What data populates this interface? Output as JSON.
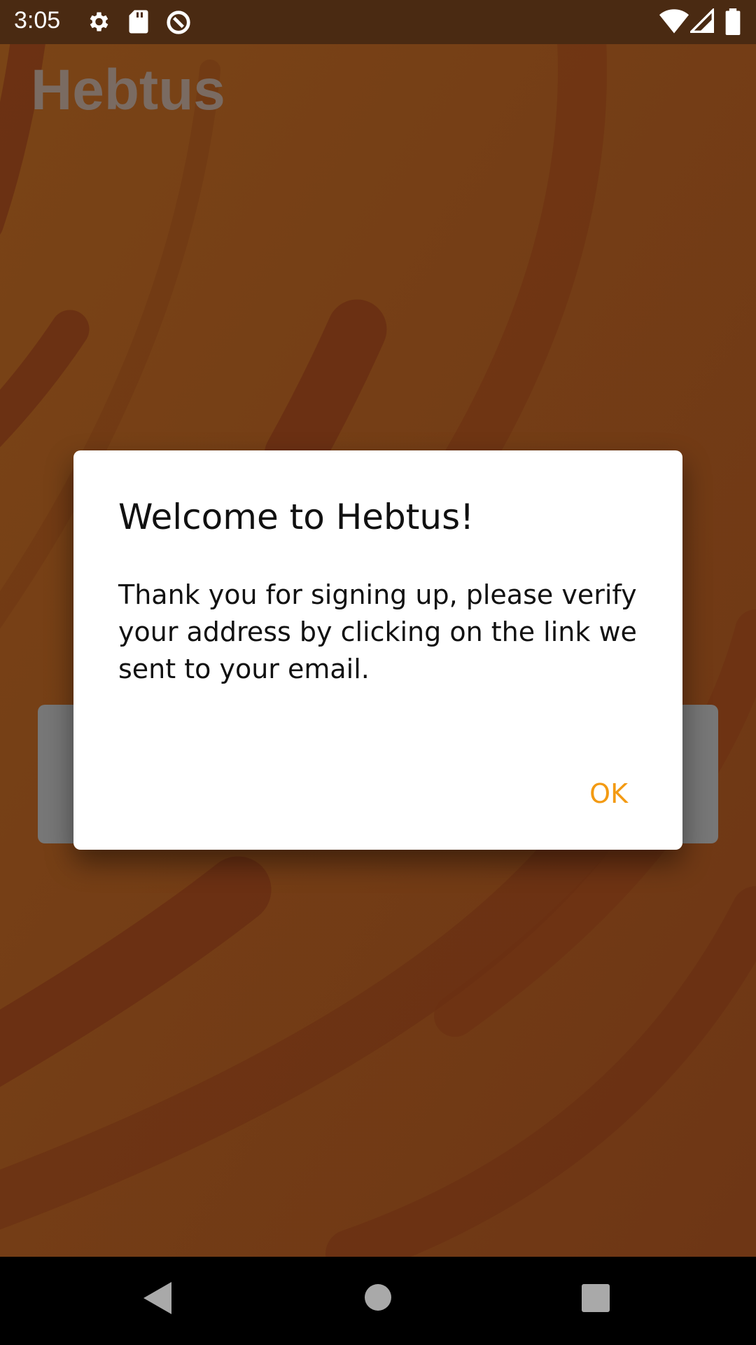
{
  "status_bar": {
    "time": "3:05",
    "left_icons": [
      "gear-icon",
      "sd-card-icon",
      "location-off-icon"
    ],
    "right_icons": [
      "wifi-icon",
      "signal-icon",
      "battery-icon"
    ]
  },
  "app": {
    "title": "Hebtus"
  },
  "dialog": {
    "title": "Welcome to Hebtus!",
    "message": "Thank you for signing up, please verify your address by clicking on the link we sent to your email.",
    "ok_label": "OK",
    "accent_color": "#f39a12"
  },
  "nav_bar": {
    "icons": [
      "back-icon",
      "home-icon",
      "recents-icon"
    ]
  }
}
